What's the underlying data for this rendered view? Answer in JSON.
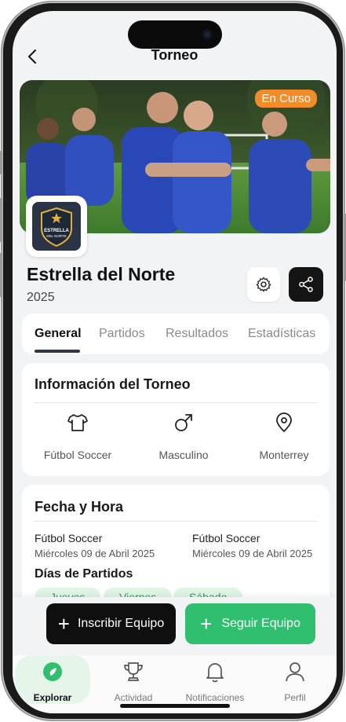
{
  "header": {
    "title": "Torneo"
  },
  "hero": {
    "status_badge": "En Curso"
  },
  "logo": {
    "line1": "ESTRELLA",
    "line2": "DEL NORTE"
  },
  "team": {
    "name": "Estrella del Norte",
    "year": "2025"
  },
  "tabs": [
    {
      "label": "General",
      "active": true
    },
    {
      "label": "Partidos",
      "active": false
    },
    {
      "label": "Resultados",
      "active": false
    },
    {
      "label": "Estadísticas",
      "active": false
    }
  ],
  "info": {
    "title": "Información del Torneo",
    "items": [
      {
        "icon": "jersey-icon",
        "label": "Fútbol Soccer"
      },
      {
        "icon": "male-icon",
        "label": "Masculino"
      },
      {
        "icon": "location-pin-icon",
        "label": "Monterrey"
      }
    ]
  },
  "schedule": {
    "title": "Fecha y Hora",
    "start": {
      "sport": "Fútbol Soccer",
      "date": "Miércoles 09 de Abril 2025"
    },
    "end": {
      "sport": "Fútbol Soccer",
      "date": "Miércoles 09 de Abril 2025"
    },
    "days_title": "Días de Partidos",
    "days": [
      "Jueves",
      "Viernes",
      "Sábado"
    ]
  },
  "actions": {
    "register": "Inscribir Equipo",
    "follow": "Seguir Equipo"
  },
  "nav": [
    {
      "label": "Explorar",
      "icon": "compass-icon",
      "active": true
    },
    {
      "label": "Actividad",
      "icon": "trophy-icon",
      "active": false
    },
    {
      "label": "Notificaciones",
      "icon": "bell-icon",
      "active": false
    },
    {
      "label": "Perfil",
      "icon": "user-icon",
      "active": false
    }
  ],
  "colors": {
    "accent_green": "#2fbf6e",
    "badge_orange": "#f28c28",
    "dark": "#0f0f0f",
    "background": "#f2f3f5"
  }
}
